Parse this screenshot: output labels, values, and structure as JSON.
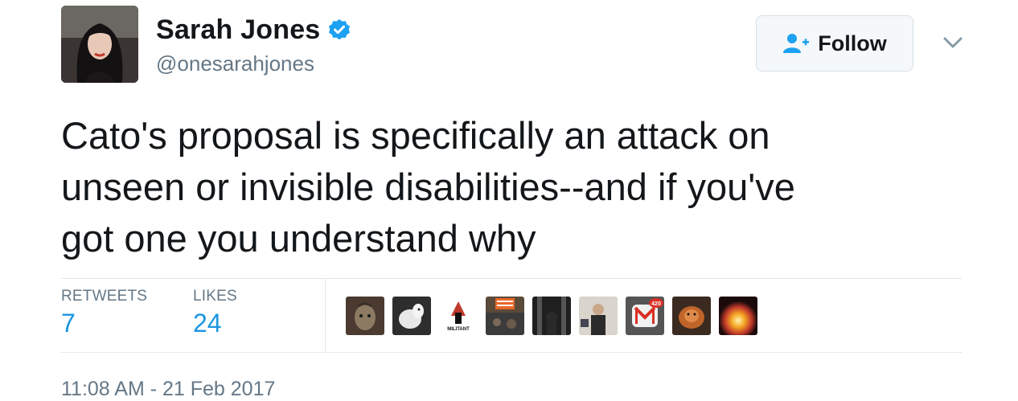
{
  "author": {
    "display_name": "Sarah Jones",
    "handle": "@onesarahjones",
    "verified": true
  },
  "follow_button": {
    "label": "Follow"
  },
  "tweet": {
    "text_lines": [
      "Cato's proposal is specifically an attack on",
      "unseen or invisible disabilities--and if you've",
      "got one you understand why"
    ],
    "timestamp": "11:08 AM - 21 Feb 2017"
  },
  "stats": {
    "retweets_label": "RETWEETS",
    "retweets_value": "7",
    "likes_label": "LIKES",
    "likes_value": "24"
  },
  "likers": [
    {
      "name": "liker-avatar-1"
    },
    {
      "name": "liker-avatar-2"
    },
    {
      "name": "liker-avatar-3",
      "text": "MILITANT"
    },
    {
      "name": "liker-avatar-4"
    },
    {
      "name": "liker-avatar-5"
    },
    {
      "name": "liker-avatar-6"
    },
    {
      "name": "liker-avatar-7",
      "badge": "420"
    },
    {
      "name": "liker-avatar-8"
    },
    {
      "name": "liker-avatar-9"
    }
  ],
  "colors": {
    "link_blue": "#1b95e0",
    "verified_blue": "#1da1f2",
    "secondary_text": "#657786",
    "divider": "#e1e8ed"
  }
}
